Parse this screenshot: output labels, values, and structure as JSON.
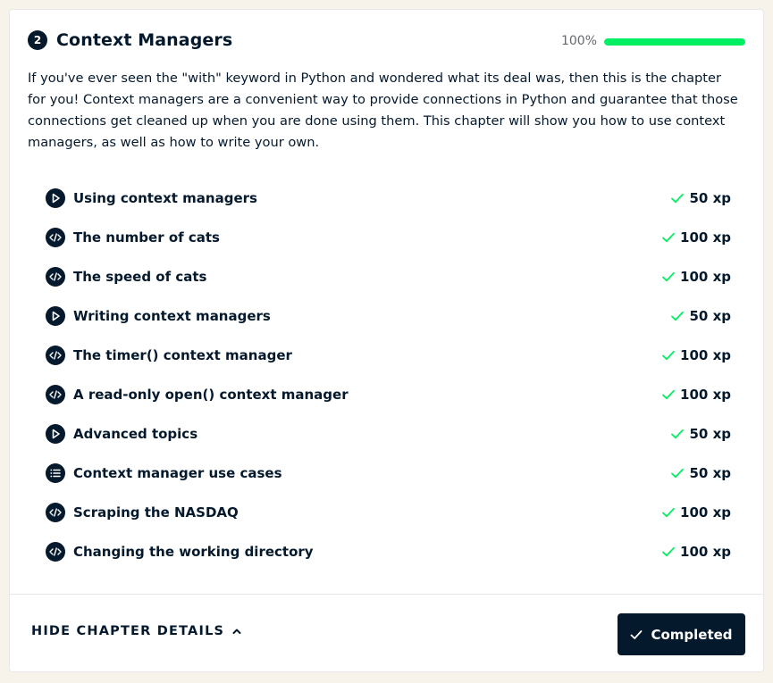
{
  "chapter": {
    "number": "2",
    "title": "Context Managers",
    "progress_label": "100%",
    "progress_fraction": 1.0,
    "description": "If you've ever seen the \"with\" keyword in Python and wondered what its deal was, then this is the chapter for you! Context managers are a convenient way to provide connections in Python and guarantee that those connections get cleaned up when you are done using them. This chapter will show you how to use context managers, as well as how to write your own."
  },
  "exercises": [
    {
      "icon": "play-icon",
      "title": "Using context managers",
      "xp": "50 xp"
    },
    {
      "icon": "code-icon",
      "title": "The number of cats",
      "xp": "100 xp"
    },
    {
      "icon": "code-icon",
      "title": "The speed of cats",
      "xp": "100 xp"
    },
    {
      "icon": "play-icon",
      "title": "Writing context managers",
      "xp": "50 xp"
    },
    {
      "icon": "code-icon",
      "title": "The timer() context manager",
      "xp": "100 xp"
    },
    {
      "icon": "code-icon",
      "title": "A read-only open() context manager",
      "xp": "100 xp"
    },
    {
      "icon": "play-icon",
      "title": "Advanced topics",
      "xp": "50 xp"
    },
    {
      "icon": "list-icon",
      "title": "Context manager use cases",
      "xp": "50 xp"
    },
    {
      "icon": "code-icon",
      "title": "Scraping the NASDAQ",
      "xp": "100 xp"
    },
    {
      "icon": "code-icon",
      "title": "Changing the working directory",
      "xp": "100 xp"
    }
  ],
  "footer": {
    "toggle_label": "HIDE CHAPTER DETAILS",
    "completed_label": "Completed"
  },
  "colors": {
    "navy": "#05192d",
    "progress_green": "#03ef62",
    "check_green": "#03ef62",
    "background": "#f7f3eb"
  }
}
